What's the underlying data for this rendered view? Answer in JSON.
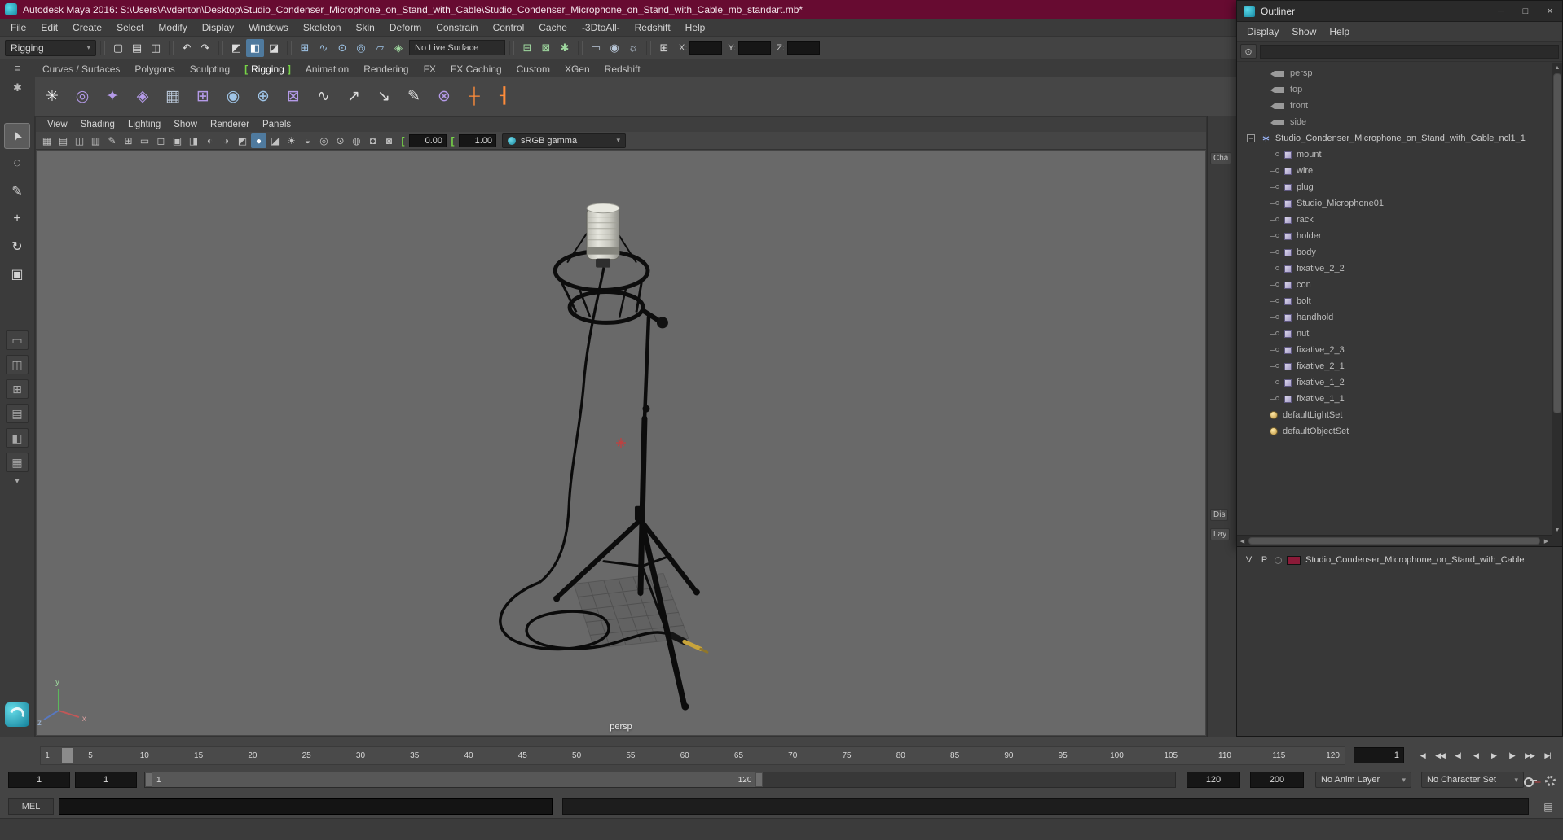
{
  "window": {
    "title": "Autodesk Maya 2016: S:\\Users\\Avdenton\\Desktop\\Studio_Condenser_Microphone_on_Stand_with_Cable\\Studio_Condenser_Microphone_on_Stand_with_Cable_mb_standart.mb*"
  },
  "menubar": {
    "items": [
      "File",
      "Edit",
      "Create",
      "Select",
      "Modify",
      "Display",
      "Windows",
      "Skeleton",
      "Skin",
      "Deform",
      "Constrain",
      "Control",
      "Cache",
      "-3DtoAll-",
      "Redshift",
      "Help"
    ]
  },
  "statusline": {
    "menuset": "Rigging",
    "file_icons": [
      {
        "g": "▢",
        "c": "cLight",
        "n": "new-scene-icon"
      },
      {
        "g": "▤",
        "c": "cLight",
        "n": "open-scene-icon"
      },
      {
        "g": "◫",
        "c": "cLight",
        "n": "save-scene-icon"
      }
    ],
    "edit_icons": [
      {
        "g": "↶",
        "c": "cLight",
        "n": "undo-icon"
      },
      {
        "g": "↷",
        "c": "cLight",
        "n": "redo-icon"
      }
    ],
    "select_icons": [
      {
        "g": "◩",
        "c": "cLight",
        "n": "select-hierarchy-icon"
      },
      {
        "g": "◧",
        "c": "active",
        "n": "select-object-icon"
      },
      {
        "g": "◪",
        "c": "cLight",
        "n": "select-component-icon"
      }
    ],
    "snap_icons": [
      {
        "g": "⊞",
        "c": "cBlue",
        "n": "snap-to-grids-icon"
      },
      {
        "g": "∿",
        "c": "cBlue",
        "n": "snap-to-curves-icon"
      },
      {
        "g": "⊙",
        "c": "cBlue",
        "n": "snap-to-points-icon"
      },
      {
        "g": "◎",
        "c": "cBlue",
        "n": "snap-to-projected-center-icon"
      },
      {
        "g": "▱",
        "c": "cBlue",
        "n": "snap-to-view-planes-icon"
      },
      {
        "g": "◈",
        "c": "cGreen",
        "n": "make-live-icon"
      }
    ],
    "live_surface": "No Live Surface",
    "history_icons": [
      {
        "g": "⊟",
        "c": "cGreen",
        "n": "inputs-to-selected-icon"
      },
      {
        "g": "⊠",
        "c": "cGreen",
        "n": "outputs-from-selected-icon"
      },
      {
        "g": "✱",
        "c": "cGreen",
        "n": "construction-history-icon"
      }
    ],
    "render_icons": [
      {
        "g": "▭",
        "c": "cSteel",
        "n": "render-current-frame-icon"
      },
      {
        "g": "◉",
        "c": "cSteel",
        "n": "ipr-render-icon"
      },
      {
        "g": "☼",
        "c": "cSteel",
        "n": "render-settings-icon"
      }
    ],
    "panel_icons": [
      {
        "g": "⊞",
        "c": "cLight",
        "n": "show-sidebar-icon"
      }
    ],
    "coords": {
      "x_label": "X:",
      "y_label": "Y:",
      "z_label": "Z:",
      "x": "",
      "y": "",
      "z": ""
    }
  },
  "shelf": {
    "corner_icons": [
      {
        "g": "≡",
        "n": "shelf-menu-icon"
      },
      {
        "g": "✱",
        "n": "shelf-gear-icon"
      }
    ],
    "tabs": [
      {
        "label": "Curves / Surfaces"
      },
      {
        "label": "Polygons"
      },
      {
        "label": "Sculpting"
      },
      {
        "label": "Rigging",
        "c": "active"
      },
      {
        "label": "Animation"
      },
      {
        "label": "Rendering"
      },
      {
        "label": "FX"
      },
      {
        "label": "FX Caching"
      },
      {
        "label": "Custom"
      },
      {
        "label": "XGen"
      },
      {
        "label": "Redshift"
      }
    ],
    "icons": [
      {
        "g": "✳",
        "c": "cWhite",
        "n": "create-joint-icon"
      },
      {
        "g": "◎",
        "c": "cPurple",
        "n": "ik-handle-icon"
      },
      {
        "g": "✦",
        "c": "cPurple",
        "n": "ik-spline-icon"
      },
      {
        "g": "◈",
        "c": "cPurple",
        "n": "insert-joint-icon"
      },
      {
        "g": "▦",
        "c": "cSteel",
        "n": "bind-skin-icon"
      },
      {
        "g": "⊞",
        "c": "cPurple",
        "n": "paint-skin-weights-icon"
      },
      {
        "g": "◉",
        "c": "cBlue",
        "n": "cluster-icon"
      },
      {
        "g": "⊕",
        "c": "cBlue",
        "n": "lattice-icon"
      },
      {
        "g": "⊠",
        "c": "cPurple",
        "n": "wrap-deformer-icon"
      },
      {
        "g": "∿",
        "c": "cLight",
        "n": "wire-deformer-icon"
      },
      {
        "g": "↗",
        "c": "cLight",
        "n": "parent-constraint-icon"
      },
      {
        "g": "↘",
        "c": "cLight",
        "n": "point-constraint-icon"
      },
      {
        "g": "✎",
        "c": "cLight",
        "n": "paint-tool-icon"
      },
      {
        "g": "⊗",
        "c": "cPurple",
        "n": "pole-vector-icon"
      },
      {
        "g": "┼",
        "c": "cOrange",
        "n": "add-attribute-icon"
      },
      {
        "g": "┨",
        "c": "cOrange",
        "n": "edit-attribute-icon"
      }
    ]
  },
  "toolbox": {
    "tools": [
      {
        "g": "➤",
        "c": "active",
        "n": "select-tool"
      },
      {
        "g": "◌",
        "n": "lasso-select-tool"
      },
      {
        "g": "✎",
        "n": "paint-select-tool"
      },
      {
        "g": "+",
        "n": "move-tool"
      },
      {
        "g": "↻",
        "n": "rotate-tool"
      },
      {
        "g": "▣",
        "n": "scale-tool"
      }
    ],
    "layouts": [
      {
        "g": "▭",
        "n": "layout-single-pane-button"
      },
      {
        "g": "◫",
        "n": "layout-two-pane-button"
      },
      {
        "g": "⊞",
        "n": "layout-four-pane-button"
      },
      {
        "g": "▤",
        "n": "layout-three-pane-button"
      },
      {
        "g": "◧",
        "n": "layout-persp-outliner-button"
      },
      {
        "g": "▦",
        "n": "layout-preset-button"
      }
    ],
    "caret": "▾"
  },
  "viewport": {
    "menus": [
      "View",
      "Shading",
      "Lighting",
      "Show",
      "Renderer",
      "Panels"
    ],
    "icons": [
      {
        "g": "▦",
        "n": "select-camera-icon"
      },
      {
        "g": "▤",
        "n": "bookmark-icon"
      },
      {
        "g": "◫",
        "n": "image-plane-icon"
      },
      {
        "g": "▥",
        "n": "2d-pan-zoom-icon"
      },
      {
        "g": "✎",
        "n": "grease-pencil-icon"
      },
      {
        "g": "⊞",
        "n": "grid-icon"
      },
      {
        "g": "▭",
        "n": "film-gate-icon"
      },
      {
        "g": "◻",
        "n": "resolution-gate-icon"
      },
      {
        "g": "▣",
        "n": "gate-mask-icon"
      },
      {
        "g": "◨",
        "n": "field-chart-icon"
      },
      {
        "g": "◐",
        "n": "safe-action-icon"
      },
      {
        "g": "◑",
        "n": "safe-title-icon"
      },
      {
        "g": "◩",
        "n": "wireframe-icon"
      },
      {
        "g": "●",
        "c": "active",
        "n": "shaded-mode-icon"
      },
      {
        "g": "◪",
        "n": "textured-mode-icon"
      },
      {
        "g": "☀",
        "c": "cYellow",
        "n": "use-all-lights-icon"
      },
      {
        "g": "◒",
        "n": "shadows-icon"
      },
      {
        "g": "◎",
        "c": "cTeal",
        "n": "screen-space-ao-icon"
      },
      {
        "g": "⊙",
        "n": "motion-blur-icon"
      },
      {
        "g": "◍",
        "n": "multisampling-icon"
      },
      {
        "g": "◘",
        "n": "xray-icon"
      },
      {
        "g": "◙",
        "n": "isolate-select-icon"
      }
    ],
    "exposure_value": "0.00",
    "gamma_value": "1.00",
    "colorspace": "sRGB gamma",
    "persp_label": "persp",
    "axis_y": "y",
    "axis_x": "x",
    "axis_z": "z"
  },
  "channelstrip": {
    "tabs": [
      {
        "label": "Cha",
        "c": "t0",
        "n": "tab-channel-box"
      },
      {
        "label": "Dis",
        "c": "t1",
        "n": "tab-display-layers"
      },
      {
        "label": "Lay",
        "c": "t2",
        "n": "tab-anim-layers"
      }
    ]
  },
  "outliner": {
    "title": "Outliner",
    "window_buttons": [
      {
        "g": "─",
        "n": "minimize-button"
      },
      {
        "g": "□",
        "n": "maximize-button"
      },
      {
        "g": "×",
        "n": "close-button"
      }
    ],
    "menus": [
      "Display",
      "Show",
      "Help"
    ],
    "rows": [
      {
        "label": "persp",
        "type": "camera"
      },
      {
        "label": "top",
        "type": "camera"
      },
      {
        "label": "front",
        "type": "camera"
      },
      {
        "label": "side",
        "type": "camera"
      },
      {
        "label": "Studio_Condenser_Microphone_on_Stand_with_Cable_ncl1_1",
        "type": "root"
      },
      {
        "label": "mount",
        "type": "child"
      },
      {
        "label": "wire",
        "type": "child"
      },
      {
        "label": "plug",
        "type": "child"
      },
      {
        "label": "Studio_Microphone01",
        "type": "child"
      },
      {
        "label": "rack",
        "type": "child"
      },
      {
        "label": "holder",
        "type": "child"
      },
      {
        "label": "body",
        "type": "child"
      },
      {
        "label": "fixative_2_2",
        "type": "child"
      },
      {
        "label": "con",
        "type": "child"
      },
      {
        "label": "bolt",
        "type": "child"
      },
      {
        "label": "handhold",
        "type": "child"
      },
      {
        "label": "nut",
        "type": "child"
      },
      {
        "label": "fixative_2_3",
        "type": "child"
      },
      {
        "label": "fixative_2_1",
        "type": "child"
      },
      {
        "label": "fixative_1_2",
        "type": "child"
      },
      {
        "label": "fixative_1_1",
        "type": "childEnd"
      },
      {
        "label": "defaultLightSet",
        "type": "set"
      },
      {
        "label": "defaultObjectSet",
        "type": "set"
      }
    ]
  },
  "layer_editor": {
    "v_label": "V",
    "p_label": "P",
    "layer_name": "Studio_Condenser_Microphone_on_Stand_with_Cable"
  },
  "timeline": {
    "ticks": [
      "1",
      "5",
      "10",
      "15",
      "20",
      "25",
      "30",
      "35",
      "40",
      "45",
      "50",
      "55",
      "60",
      "65",
      "70",
      "75",
      "80",
      "85",
      "90",
      "95",
      "100",
      "105",
      "110",
      "115",
      "120"
    ],
    "current_frame": "1",
    "playback": [
      {
        "g": "|◀",
        "n": "go-to-start-button"
      },
      {
        "g": "◀◀",
        "n": "step-back-frame-button"
      },
      {
        "g": "◀|",
        "n": "step-back-key-button"
      },
      {
        "g": "◀",
        "n": "play-backwards-button"
      },
      {
        "g": "▶",
        "n": "play-forwards-button"
      },
      {
        "g": "|▶",
        "n": "step-forward-key-button"
      },
      {
        "g": "▶▶",
        "n": "step-forward-frame-button"
      },
      {
        "g": "▶|",
        "n": "go-to-end-button"
      }
    ]
  },
  "rangeslider": {
    "anim_start": "1",
    "play_start": "1",
    "thumb_start": "1",
    "thumb_end": "120",
    "play_end": "120",
    "anim_end": "200",
    "anim_layer": "No Anim Layer",
    "character_set": "No Character Set"
  },
  "mel": {
    "label": "MEL",
    "input_value": "",
    "result_value": ""
  },
  "helpline": {
    "text": ""
  },
  "colors": {
    "titlebar": "#670b31",
    "viewport_bg": "#696969",
    "active_blue": "#4f7a9e",
    "bracket_green": "#77d447",
    "layer_swatch": "#8b1a38",
    "maya_teal": "#1787a0"
  }
}
